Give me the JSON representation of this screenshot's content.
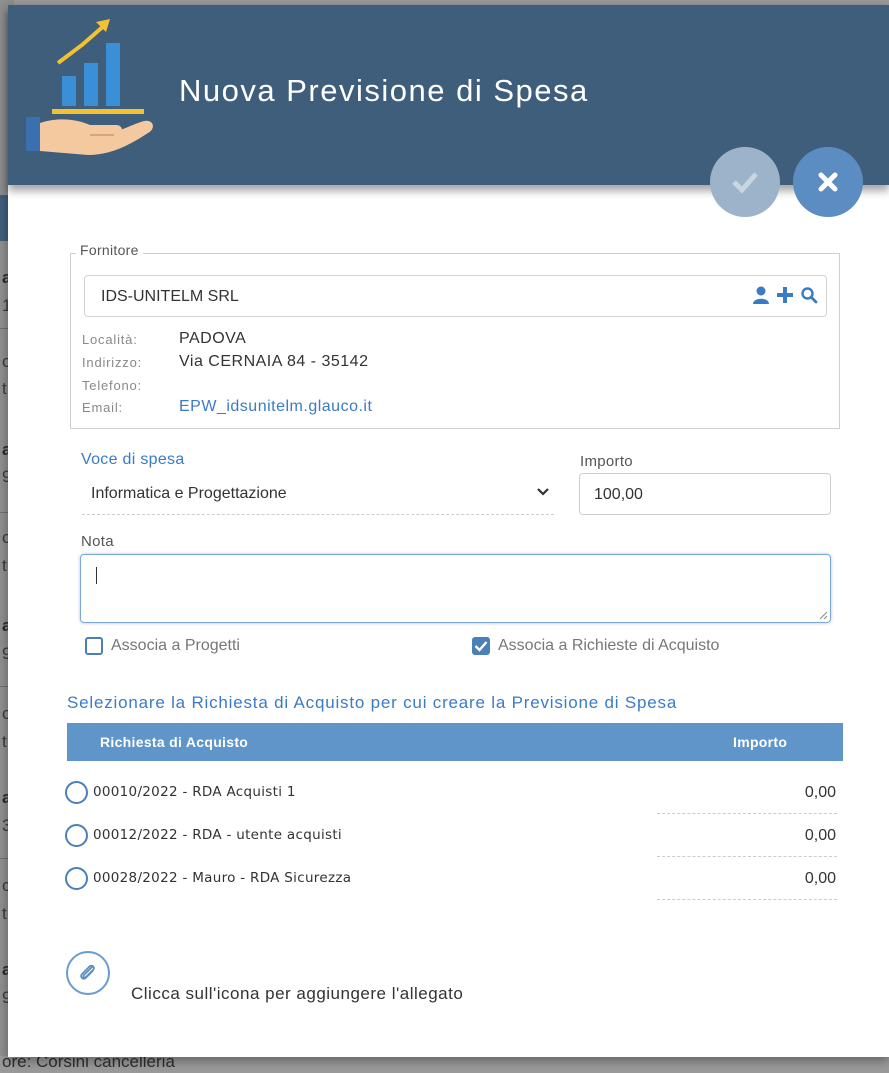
{
  "background": {
    "fragments": [
      "a",
      "1",
      "c",
      "t",
      "a",
      "9",
      "c",
      "t",
      "a",
      "9",
      "c",
      "t",
      "a",
      "3",
      "c",
      "t",
      "a",
      "9"
    ],
    "footer_text": "ore: Corsini cancelleria"
  },
  "header": {
    "title": "Nuova Previsione di Spesa",
    "logo_icon": "chart-hand-icon",
    "colors": {
      "header_bg": "#3e5e7c",
      "accent": "#3a7bc8",
      "table_header": "#5f95c9"
    }
  },
  "actions": {
    "confirm_icon": "check-icon",
    "close_icon": "close-icon"
  },
  "fornitore": {
    "legend": "Fornitore",
    "value": "IDS-UNITELM SRL",
    "icons": [
      "user-icon",
      "plus-icon",
      "search-icon"
    ],
    "localita_label": "Località:",
    "localita_value": "PADOVA",
    "indirizzo_label": "Indirizzo:",
    "indirizzo_value": "Via CERNAIA 84 - 35142",
    "telefono_label": "Telefono:",
    "telefono_value": "",
    "email_label": "Email:",
    "email_value": "EPW_idsunitelm.glauco.it"
  },
  "voce_spesa": {
    "label": "Voce di spesa",
    "selected": "Informatica e Progettazione"
  },
  "importo": {
    "label": "Importo",
    "value": "100,00"
  },
  "nota": {
    "label": "Nota",
    "value": ""
  },
  "checkboxes": {
    "associa_progetti": {
      "label": "Associa a Progetti",
      "checked": false
    },
    "associa_richieste": {
      "label": "Associa a Richieste di Acquisto",
      "checked": true
    }
  },
  "richieste": {
    "title": "Selezionare la Richiesta di Acquisto per cui creare la Previsione di Spesa",
    "col_richiesta": "Richiesta di Acquisto",
    "col_importo": "Importo",
    "rows": [
      {
        "label": "00010/2022 - RDA Acquisti 1",
        "importo": "0,00"
      },
      {
        "label": "00012/2022 - RDA - utente acquisti",
        "importo": "0,00"
      },
      {
        "label": "00028/2022 - Mauro - RDA Sicurezza",
        "importo": "0,00"
      }
    ]
  },
  "allegato": {
    "icon": "paperclip-icon",
    "text": "Clicca sull'icona per aggiungere l'allegato"
  }
}
